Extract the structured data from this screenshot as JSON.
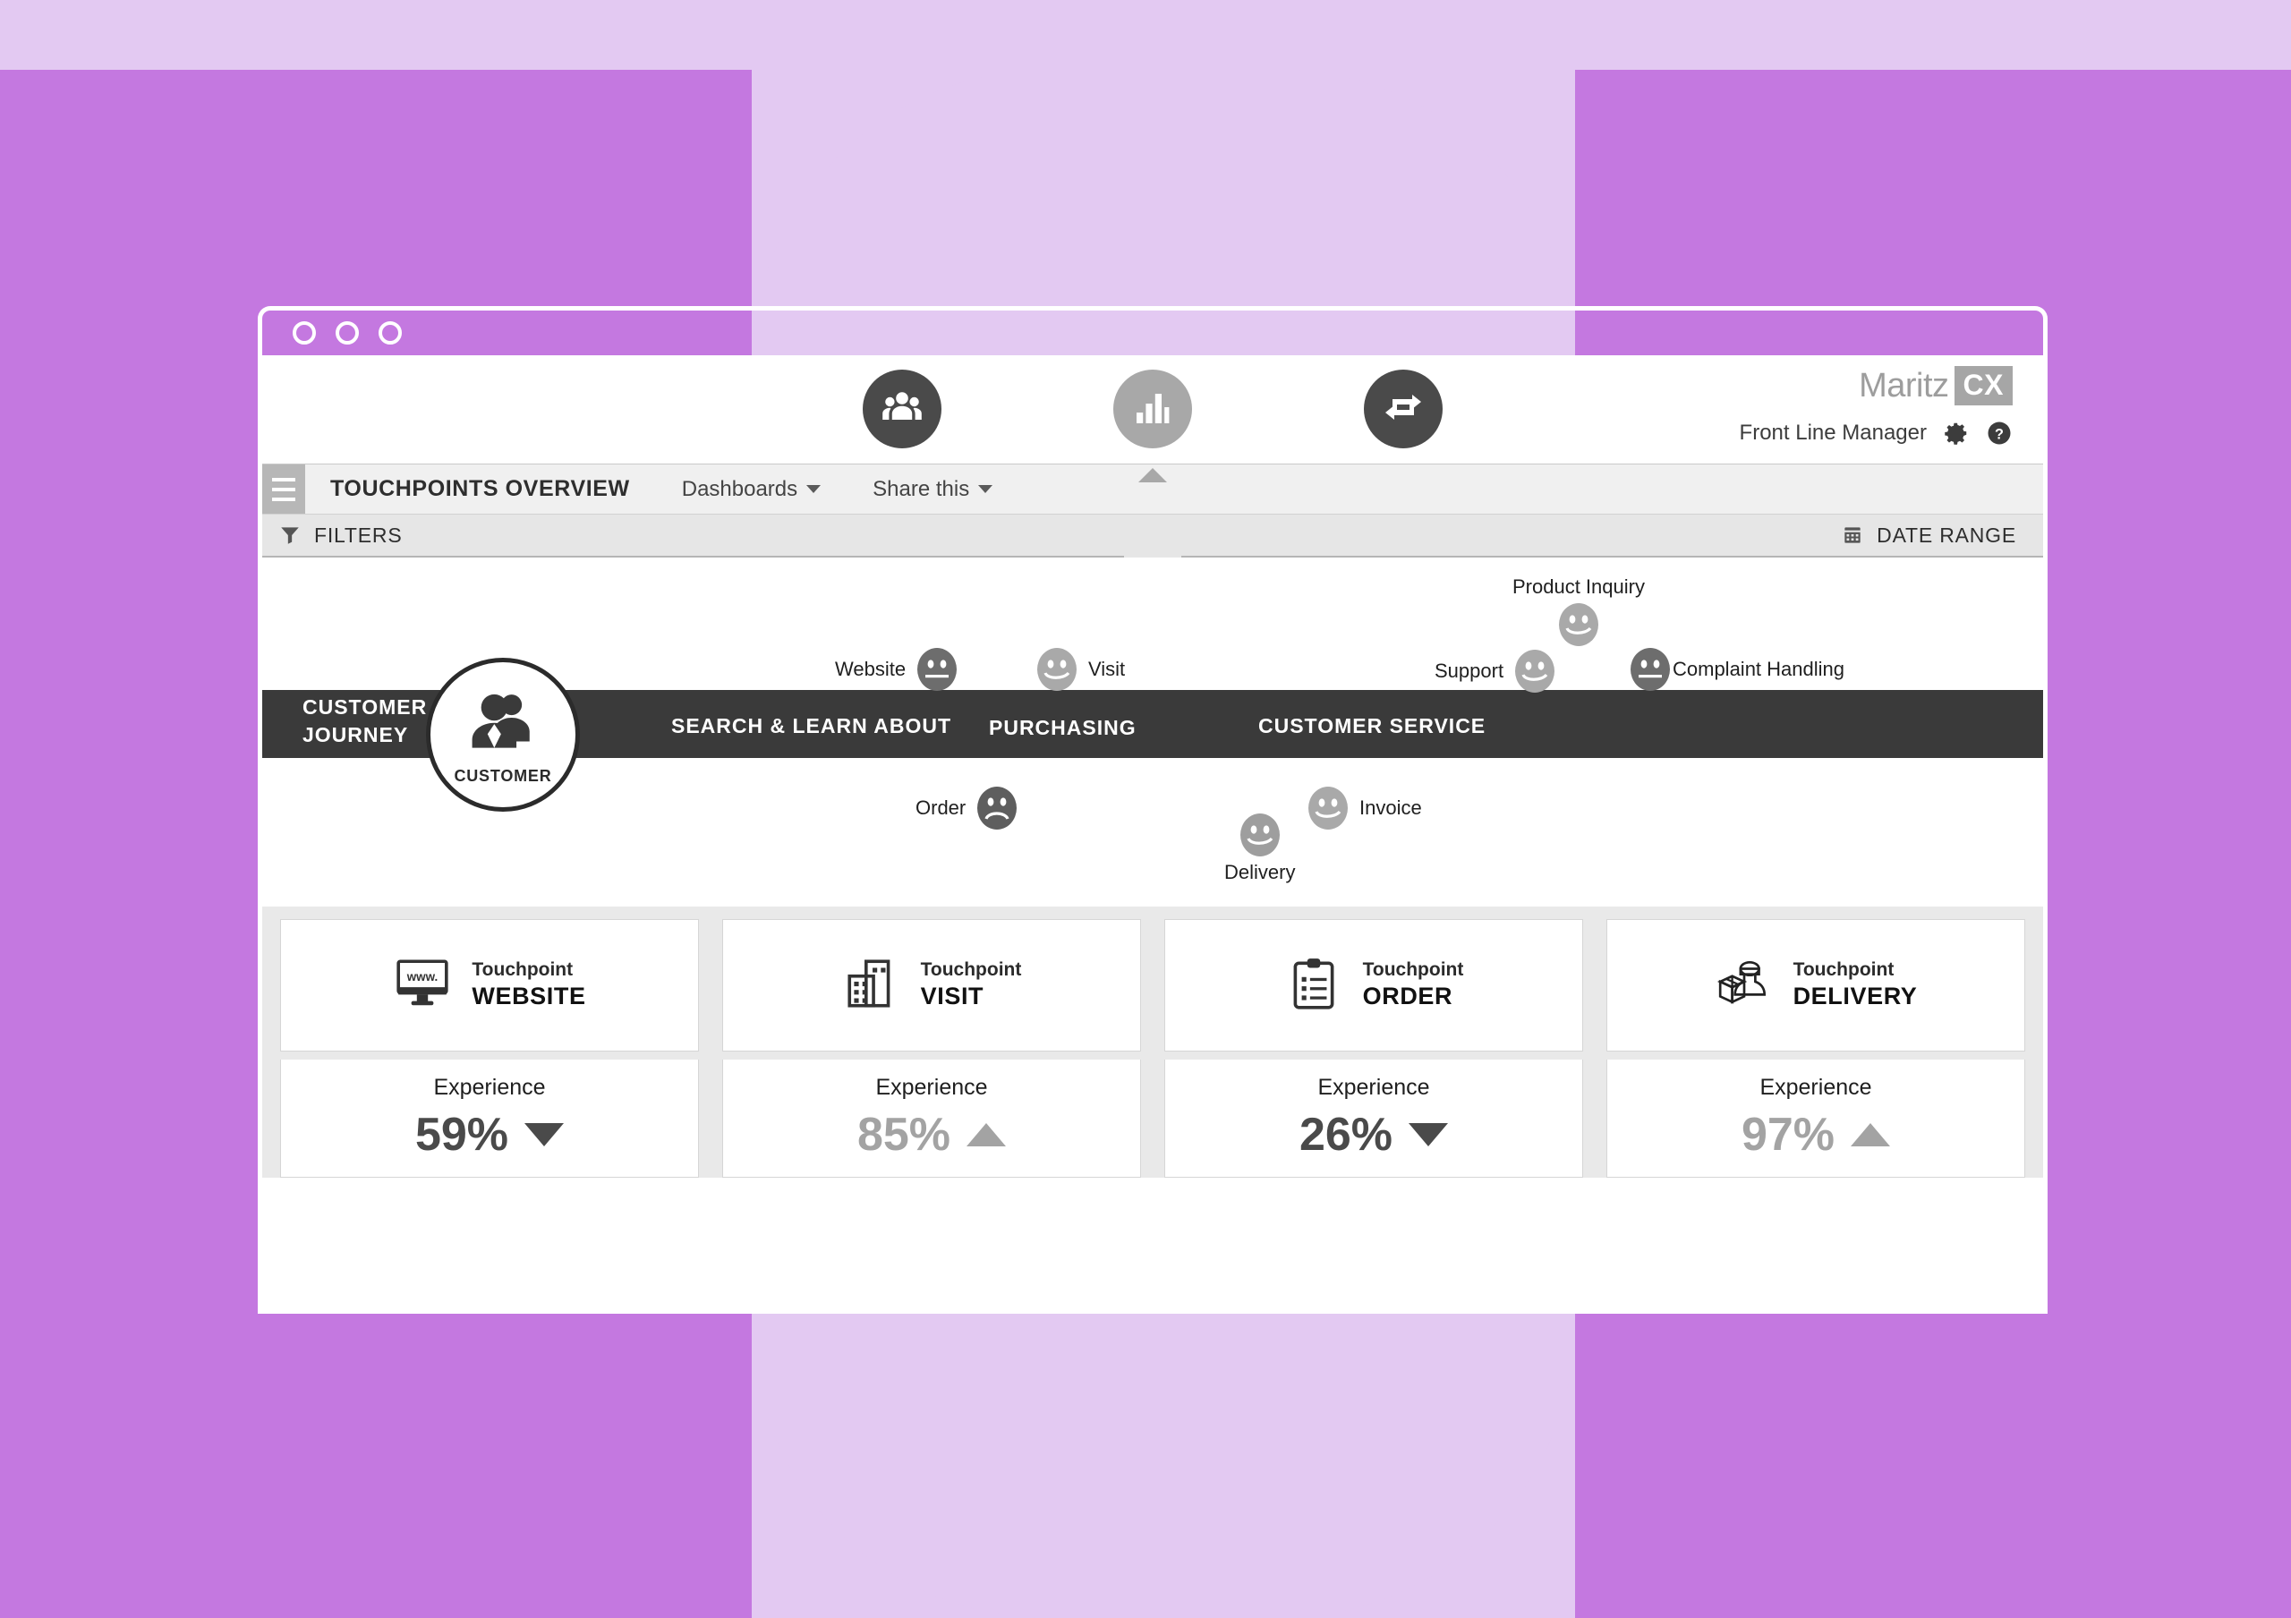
{
  "window": {
    "dots": [
      "close",
      "minimize",
      "maximize"
    ]
  },
  "header": {
    "nav": [
      {
        "name": "people-icon",
        "label": "People"
      },
      {
        "name": "bar-chart-icon",
        "label": "Dashboards",
        "active": true
      },
      {
        "name": "loop-arrows-icon",
        "label": "Workflow"
      }
    ],
    "brand_primary": "Maritz",
    "brand_secondary": "CX",
    "user_role": "Front Line Manager",
    "settings_icon": "gear-icon",
    "help_icon": "help-circle-icon"
  },
  "toolbar": {
    "menu_icon": "hamburger-icon",
    "title": "TOUCHPOINTS OVERVIEW",
    "dashboards_label": "Dashboards",
    "share_label": "Share this"
  },
  "filters": {
    "filter_icon": "funnel-icon",
    "filters_label": "FILTERS",
    "calendar_icon": "calendar-icon",
    "date_range_label": "DATE RANGE"
  },
  "journey": {
    "title_line1": "CUSTOMER",
    "title_line2": "JOURNEY",
    "customer_label": "CUSTOMER",
    "stages": [
      {
        "label": "SEARCH & LEARN ABOUT"
      },
      {
        "label": "PURCHASING"
      },
      {
        "label": "CUSTOMER SERVICE"
      }
    ],
    "touchpoints": [
      {
        "label": "Website",
        "mood": "neutral",
        "tone": "dark"
      },
      {
        "label": "Visit",
        "mood": "happy",
        "tone": "light"
      },
      {
        "label": "Product Inquiry",
        "mood": "happy",
        "tone": "light"
      },
      {
        "label": "Support",
        "mood": "happy",
        "tone": "light"
      },
      {
        "label": "Complaint Handling",
        "mood": "neutral",
        "tone": "dark"
      },
      {
        "label": "Order",
        "mood": "sad",
        "tone": "dark"
      },
      {
        "label": "Delivery",
        "mood": "happy",
        "tone": "medium"
      },
      {
        "label": "Invoice",
        "mood": "happy",
        "tone": "light"
      }
    ]
  },
  "cards": [
    {
      "icon": "monitor-www-icon",
      "kicker": "Touchpoint",
      "name": "WEBSITE",
      "metric_label": "Experience",
      "metric_value": "59%",
      "trend": "down",
      "emphasis": "dark"
    },
    {
      "icon": "building-icon",
      "kicker": "Touchpoint",
      "name": "VISIT",
      "metric_label": "Experience",
      "metric_value": "85%",
      "trend": "up",
      "emphasis": "light"
    },
    {
      "icon": "clipboard-list-icon",
      "kicker": "Touchpoint",
      "name": "ORDER",
      "metric_label": "Experience",
      "metric_value": "26%",
      "trend": "down",
      "emphasis": "dark"
    },
    {
      "icon": "delivery-person-box-icon",
      "kicker": "Touchpoint",
      "name": "DELIVERY",
      "metric_label": "Experience",
      "metric_value": "97%",
      "trend": "up",
      "emphasis": "light"
    }
  ],
  "colors": {
    "background_light": "#e3c9f2",
    "background_accent": "#c478e0",
    "band_dark": "#3a3a3a",
    "metric_dark": "#4a4a4a",
    "metric_light": "#a3a3a3"
  }
}
